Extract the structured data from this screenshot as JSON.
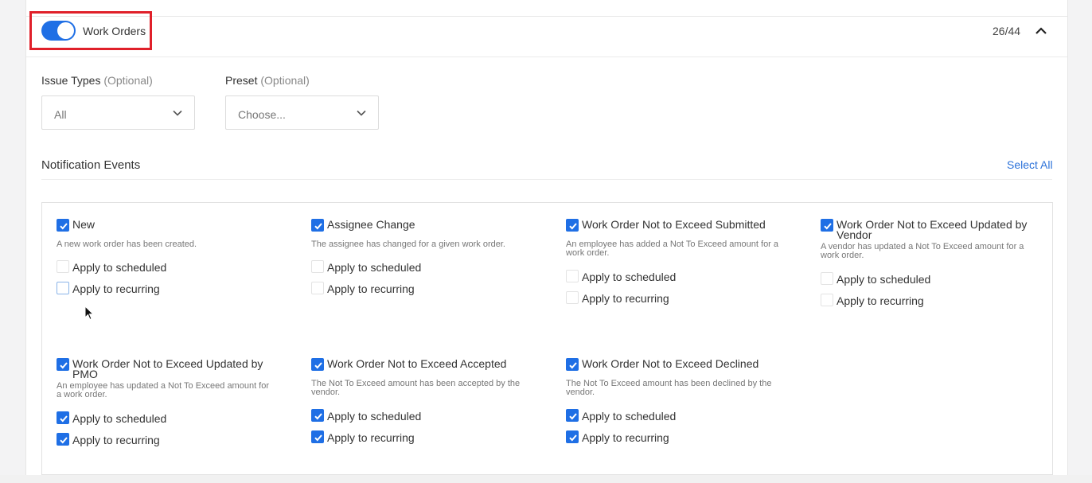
{
  "header": {
    "toggle_label": "Work Orders",
    "toggle_on": true,
    "count": "26/44",
    "accent_color": "#1f6fe5",
    "highlight_color": "#e0202a"
  },
  "filters": {
    "issue_types": {
      "label": "Issue Types",
      "optional": "(Optional)",
      "value": "All"
    },
    "preset": {
      "label": "Preset",
      "optional": "(Optional)",
      "placeholder": "Choose..."
    }
  },
  "section": {
    "title": "Notification Events",
    "select_all": "Select All"
  },
  "events": [
    {
      "title": "New",
      "description": "A new work order has been created.",
      "checked": true,
      "scheduled_label": "Apply to scheduled",
      "scheduled": false,
      "recurring_label": "Apply to recurring",
      "recurring": false
    },
    {
      "title": "Assignee Change",
      "description": "The assignee has changed for a given work order.",
      "checked": true,
      "scheduled_label": "Apply to scheduled",
      "scheduled": false,
      "recurring_label": "Apply to recurring",
      "recurring": false
    },
    {
      "title": "Work Order Not to Exceed Submitted",
      "description": "An employee has added a Not To Exceed amount for a work order.",
      "checked": true,
      "scheduled_label": "Apply to scheduled",
      "scheduled": false,
      "recurring_label": "Apply to recurring",
      "recurring": false
    },
    {
      "title": "Work Order Not to Exceed Updated by Vendor",
      "description": "A vendor has updated a Not To Exceed amount for a work order.",
      "checked": true,
      "scheduled_label": "Apply to scheduled",
      "scheduled": false,
      "recurring_label": "Apply to recurring",
      "recurring": false
    },
    {
      "title": "Work Order Not to Exceed Updated by PMO",
      "description": "An employee has updated a Not To Exceed amount for a work order.",
      "checked": true,
      "scheduled_label": "Apply to scheduled",
      "scheduled": true,
      "recurring_label": "Apply to recurring",
      "recurring": true
    },
    {
      "title": "Work Order Not to Exceed Accepted",
      "description": "The Not To Exceed amount has been accepted by the vendor.",
      "checked": true,
      "scheduled_label": "Apply to scheduled",
      "scheduled": true,
      "recurring_label": "Apply to recurring",
      "recurring": true
    },
    {
      "title": "Work Order Not to Exceed Declined",
      "description": "The Not To Exceed amount has been declined by the vendor.",
      "checked": true,
      "scheduled_label": "Apply to scheduled",
      "scheduled": true,
      "recurring_label": "Apply to recurring",
      "recurring": true
    }
  ]
}
